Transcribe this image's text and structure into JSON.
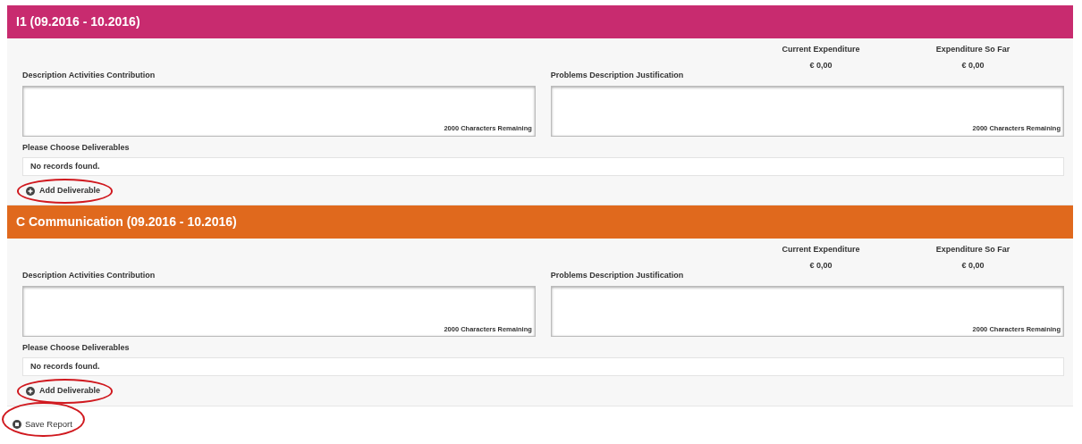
{
  "sections": [
    {
      "title": "I1 (09.2016 - 10.2016)",
      "color": "#c82b6f",
      "current_expenditure": {
        "label": "Current Expenditure",
        "value": "€ 0,00"
      },
      "expenditure_so_far": {
        "label": "Expenditure So Far",
        "value": "€ 0,00"
      },
      "description": {
        "label": "Description Activities Contribution",
        "counter": "2000 Characters Remaining"
      },
      "problems": {
        "label": "Problems Description Justification",
        "counter": "2000 Characters Remaining"
      },
      "deliverables_label": "Please Choose Deliverables",
      "deliverables_empty": "No records found.",
      "add_button": {
        "label": "Add Deliverable",
        "circled": true
      }
    },
    {
      "title": "C Communication (09.2016 - 10.2016)",
      "color": "#e0691d",
      "current_expenditure": {
        "label": "Current Expenditure",
        "value": "€ 0,00"
      },
      "expenditure_so_far": {
        "label": "Expenditure So Far",
        "value": "€ 0,00"
      },
      "description": {
        "label": "Description Activities Contribution",
        "counter": "2000 Characters Remaining"
      },
      "problems": {
        "label": "Problems Description Justification",
        "counter": "2000 Characters Remaining"
      },
      "deliverables_label": "Please Choose Deliverables",
      "deliverables_empty": "No records found.",
      "add_button": {
        "label": "Add Deliverable",
        "circled": true
      }
    }
  ],
  "save_button": {
    "label": "Save Report",
    "circled": true
  }
}
